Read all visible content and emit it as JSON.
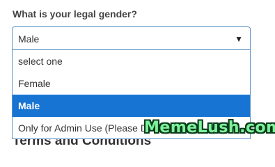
{
  "form": {
    "question": "What is your legal gender?",
    "behind_heading": "Terms and Conditions",
    "select": {
      "value": "Male",
      "arrow_icon": "▼"
    },
    "options": [
      "select one",
      "Female",
      "Male",
      "Only for Admin Use (Please Do Not Select)"
    ],
    "selected_option": "Male"
  },
  "colors": {
    "highlight": "#1874d2",
    "focus_border": "#5e93c8"
  },
  "watermark": {
    "text": "MemeLush.com"
  }
}
